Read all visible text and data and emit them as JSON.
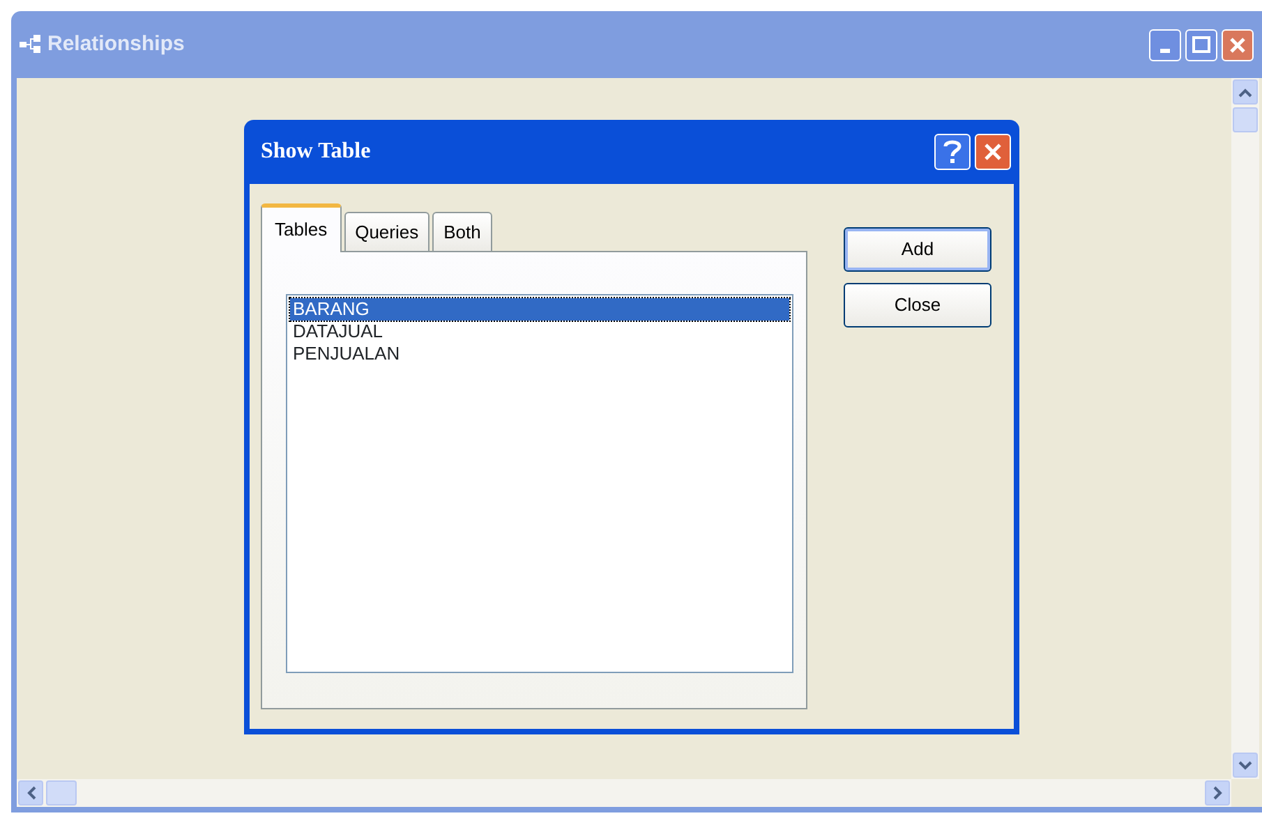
{
  "window": {
    "title": "Relationships"
  },
  "dialog": {
    "title": "Show Table",
    "tabs": [
      {
        "label": "Tables",
        "selected": true
      },
      {
        "label": "Queries",
        "selected": false
      },
      {
        "label": "Both",
        "selected": false
      }
    ],
    "items": [
      {
        "label": "BARANG",
        "selected": true
      },
      {
        "label": "DATAJUAL",
        "selected": false
      },
      {
        "label": "PENJUALAN",
        "selected": false
      }
    ],
    "buttons": [
      {
        "label": "Add",
        "default": true
      },
      {
        "label": "Close",
        "default": false
      }
    ]
  }
}
